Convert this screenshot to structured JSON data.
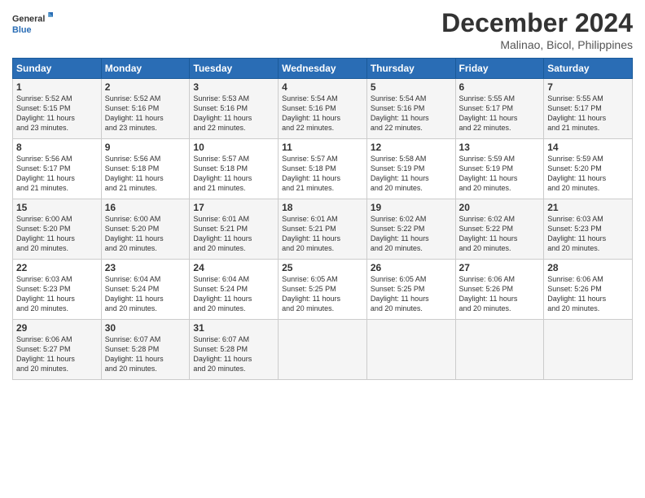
{
  "logo": {
    "line1": "General",
    "line2": "Blue"
  },
  "title": "December 2024",
  "location": "Malinao, Bicol, Philippines",
  "headers": [
    "Sunday",
    "Monday",
    "Tuesday",
    "Wednesday",
    "Thursday",
    "Friday",
    "Saturday"
  ],
  "weeks": [
    [
      {
        "day": "1",
        "info": "Sunrise: 5:52 AM\nSunset: 5:15 PM\nDaylight: 11 hours\nand 23 minutes."
      },
      {
        "day": "2",
        "info": "Sunrise: 5:52 AM\nSunset: 5:16 PM\nDaylight: 11 hours\nand 23 minutes."
      },
      {
        "day": "3",
        "info": "Sunrise: 5:53 AM\nSunset: 5:16 PM\nDaylight: 11 hours\nand 22 minutes."
      },
      {
        "day": "4",
        "info": "Sunrise: 5:54 AM\nSunset: 5:16 PM\nDaylight: 11 hours\nand 22 minutes."
      },
      {
        "day": "5",
        "info": "Sunrise: 5:54 AM\nSunset: 5:16 PM\nDaylight: 11 hours\nand 22 minutes."
      },
      {
        "day": "6",
        "info": "Sunrise: 5:55 AM\nSunset: 5:17 PM\nDaylight: 11 hours\nand 22 minutes."
      },
      {
        "day": "7",
        "info": "Sunrise: 5:55 AM\nSunset: 5:17 PM\nDaylight: 11 hours\nand 21 minutes."
      }
    ],
    [
      {
        "day": "8",
        "info": "Sunrise: 5:56 AM\nSunset: 5:17 PM\nDaylight: 11 hours\nand 21 minutes."
      },
      {
        "day": "9",
        "info": "Sunrise: 5:56 AM\nSunset: 5:18 PM\nDaylight: 11 hours\nand 21 minutes."
      },
      {
        "day": "10",
        "info": "Sunrise: 5:57 AM\nSunset: 5:18 PM\nDaylight: 11 hours\nand 21 minutes."
      },
      {
        "day": "11",
        "info": "Sunrise: 5:57 AM\nSunset: 5:18 PM\nDaylight: 11 hours\nand 21 minutes."
      },
      {
        "day": "12",
        "info": "Sunrise: 5:58 AM\nSunset: 5:19 PM\nDaylight: 11 hours\nand 20 minutes."
      },
      {
        "day": "13",
        "info": "Sunrise: 5:59 AM\nSunset: 5:19 PM\nDaylight: 11 hours\nand 20 minutes."
      },
      {
        "day": "14",
        "info": "Sunrise: 5:59 AM\nSunset: 5:20 PM\nDaylight: 11 hours\nand 20 minutes."
      }
    ],
    [
      {
        "day": "15",
        "info": "Sunrise: 6:00 AM\nSunset: 5:20 PM\nDaylight: 11 hours\nand 20 minutes."
      },
      {
        "day": "16",
        "info": "Sunrise: 6:00 AM\nSunset: 5:20 PM\nDaylight: 11 hours\nand 20 minutes."
      },
      {
        "day": "17",
        "info": "Sunrise: 6:01 AM\nSunset: 5:21 PM\nDaylight: 11 hours\nand 20 minutes."
      },
      {
        "day": "18",
        "info": "Sunrise: 6:01 AM\nSunset: 5:21 PM\nDaylight: 11 hours\nand 20 minutes."
      },
      {
        "day": "19",
        "info": "Sunrise: 6:02 AM\nSunset: 5:22 PM\nDaylight: 11 hours\nand 20 minutes."
      },
      {
        "day": "20",
        "info": "Sunrise: 6:02 AM\nSunset: 5:22 PM\nDaylight: 11 hours\nand 20 minutes."
      },
      {
        "day": "21",
        "info": "Sunrise: 6:03 AM\nSunset: 5:23 PM\nDaylight: 11 hours\nand 20 minutes."
      }
    ],
    [
      {
        "day": "22",
        "info": "Sunrise: 6:03 AM\nSunset: 5:23 PM\nDaylight: 11 hours\nand 20 minutes."
      },
      {
        "day": "23",
        "info": "Sunrise: 6:04 AM\nSunset: 5:24 PM\nDaylight: 11 hours\nand 20 minutes."
      },
      {
        "day": "24",
        "info": "Sunrise: 6:04 AM\nSunset: 5:24 PM\nDaylight: 11 hours\nand 20 minutes."
      },
      {
        "day": "25",
        "info": "Sunrise: 6:05 AM\nSunset: 5:25 PM\nDaylight: 11 hours\nand 20 minutes."
      },
      {
        "day": "26",
        "info": "Sunrise: 6:05 AM\nSunset: 5:25 PM\nDaylight: 11 hours\nand 20 minutes."
      },
      {
        "day": "27",
        "info": "Sunrise: 6:06 AM\nSunset: 5:26 PM\nDaylight: 11 hours\nand 20 minutes."
      },
      {
        "day": "28",
        "info": "Sunrise: 6:06 AM\nSunset: 5:26 PM\nDaylight: 11 hours\nand 20 minutes."
      }
    ],
    [
      {
        "day": "29",
        "info": "Sunrise: 6:06 AM\nSunset: 5:27 PM\nDaylight: 11 hours\nand 20 minutes."
      },
      {
        "day": "30",
        "info": "Sunrise: 6:07 AM\nSunset: 5:28 PM\nDaylight: 11 hours\nand 20 minutes."
      },
      {
        "day": "31",
        "info": "Sunrise: 6:07 AM\nSunset: 5:28 PM\nDaylight: 11 hours\nand 20 minutes."
      },
      {
        "day": "",
        "info": ""
      },
      {
        "day": "",
        "info": ""
      },
      {
        "day": "",
        "info": ""
      },
      {
        "day": "",
        "info": ""
      }
    ]
  ]
}
